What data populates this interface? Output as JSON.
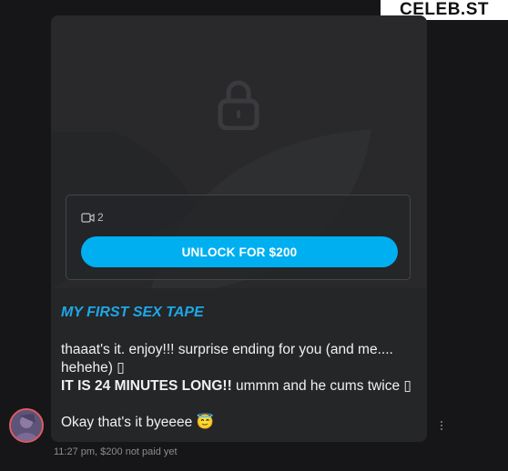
{
  "watermark": "CELEB.ST",
  "post": {
    "media_icon": "video-icon",
    "media_count": "2",
    "unlock_label": "UNLOCK FOR $200",
    "title": "MY FIRST SEX TAPE",
    "lines": [
      "thaaat's it. enjoy!!! surprise ending for you (and me.... hehehe) ▯",
      "IT IS 24 MINUTES LONG!!",
      " ummm and he cums twice ▯",
      "Okay that's it byeeee 😇"
    ],
    "time": "11:27 pm,",
    "price_status": "$200 not paid yet"
  },
  "colors": {
    "accent": "#00aff0",
    "title": "#1ea7e8",
    "card": "#252628",
    "background": "#161618",
    "avatar_ring": "#e05a62"
  }
}
